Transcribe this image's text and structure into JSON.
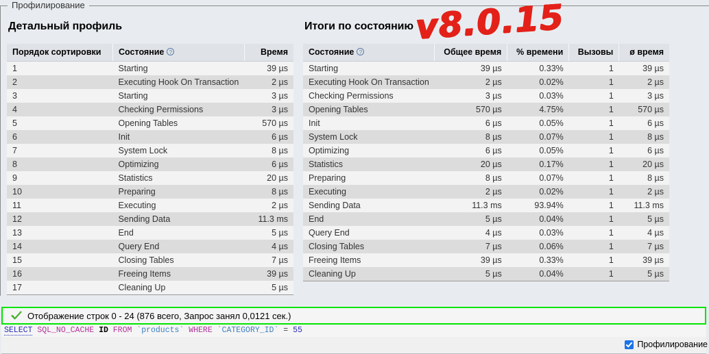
{
  "fieldset": {
    "legend": "Профилирование"
  },
  "version_annotation": "v8.0.15",
  "detailed_profile": {
    "title": "Детальный профиль",
    "columns": [
      "Порядок сортировки",
      "Состояние",
      "Время"
    ],
    "help_glyph": "?",
    "rows": [
      {
        "order": "1",
        "state": "Starting",
        "time": "39 µs"
      },
      {
        "order": "2",
        "state": "Executing Hook On Transaction",
        "time": "2 µs"
      },
      {
        "order": "3",
        "state": "Starting",
        "time": "3 µs"
      },
      {
        "order": "4",
        "state": "Checking Permissions",
        "time": "3 µs"
      },
      {
        "order": "5",
        "state": "Opening Tables",
        "time": "570 µs"
      },
      {
        "order": "6",
        "state": "Init",
        "time": "6 µs"
      },
      {
        "order": "7",
        "state": "System Lock",
        "time": "8 µs"
      },
      {
        "order": "8",
        "state": "Optimizing",
        "time": "6 µs"
      },
      {
        "order": "9",
        "state": "Statistics",
        "time": "20 µs"
      },
      {
        "order": "10",
        "state": "Preparing",
        "time": "8 µs"
      },
      {
        "order": "11",
        "state": "Executing",
        "time": "2 µs"
      },
      {
        "order": "12",
        "state": "Sending Data",
        "time": "11.3 ms"
      },
      {
        "order": "13",
        "state": "End",
        "time": "5 µs"
      },
      {
        "order": "14",
        "state": "Query End",
        "time": "4 µs"
      },
      {
        "order": "15",
        "state": "Closing Tables",
        "time": "7 µs"
      },
      {
        "order": "16",
        "state": "Freeing Items",
        "time": "39 µs"
      },
      {
        "order": "17",
        "state": "Cleaning Up",
        "time": "5 µs"
      }
    ]
  },
  "state_summary": {
    "title": "Итоги по состоянию",
    "columns": [
      "Состояние",
      "Общее время",
      "% времени",
      "Вызовы",
      "ø время"
    ],
    "help_glyph": "?",
    "rows": [
      {
        "state": "Starting",
        "total": "39 µs",
        "percent": "0.33%",
        "calls": "1",
        "avg": "39 µs"
      },
      {
        "state": "Executing Hook On Transaction",
        "total": "2 µs",
        "percent": "0.02%",
        "calls": "1",
        "avg": "2 µs"
      },
      {
        "state": "Checking Permissions",
        "total": "3 µs",
        "percent": "0.03%",
        "calls": "1",
        "avg": "3 µs"
      },
      {
        "state": "Opening Tables",
        "total": "570 µs",
        "percent": "4.75%",
        "calls": "1",
        "avg": "570 µs"
      },
      {
        "state": "Init",
        "total": "6 µs",
        "percent": "0.05%",
        "calls": "1",
        "avg": "6 µs"
      },
      {
        "state": "System Lock",
        "total": "8 µs",
        "percent": "0.07%",
        "calls": "1",
        "avg": "8 µs"
      },
      {
        "state": "Optimizing",
        "total": "6 µs",
        "percent": "0.05%",
        "calls": "1",
        "avg": "6 µs"
      },
      {
        "state": "Statistics",
        "total": "20 µs",
        "percent": "0.17%",
        "calls": "1",
        "avg": "20 µs"
      },
      {
        "state": "Preparing",
        "total": "8 µs",
        "percent": "0.07%",
        "calls": "1",
        "avg": "8 µs"
      },
      {
        "state": "Executing",
        "total": "2 µs",
        "percent": "0.02%",
        "calls": "1",
        "avg": "2 µs"
      },
      {
        "state": "Sending Data",
        "total": "11.3 ms",
        "percent": "93.94%",
        "calls": "1",
        "avg": "11.3 ms"
      },
      {
        "state": "End",
        "total": "5 µs",
        "percent": "0.04%",
        "calls": "1",
        "avg": "5 µs"
      },
      {
        "state": "Query End",
        "total": "4 µs",
        "percent": "0.03%",
        "calls": "1",
        "avg": "4 µs"
      },
      {
        "state": "Closing Tables",
        "total": "7 µs",
        "percent": "0.06%",
        "calls": "1",
        "avg": "7 µs"
      },
      {
        "state": "Freeing Items",
        "total": "39 µs",
        "percent": "0.33%",
        "calls": "1",
        "avg": "39 µs"
      },
      {
        "state": "Cleaning Up",
        "total": "5 µs",
        "percent": "0.04%",
        "calls": "1",
        "avg": "5 µs"
      }
    ]
  },
  "status": {
    "icon": "green-check-icon",
    "message": "Отображение строк 0 - 24 (876 всего, Запрос занял 0,0121 сек.)",
    "border_color": "#00e500"
  },
  "sql": {
    "tokens": [
      {
        "text": "SELECT",
        "kind": "kw-select"
      },
      {
        "text": " ",
        "kind": "punct"
      },
      {
        "text": "SQL_NO_CACHE",
        "kind": "kw-func"
      },
      {
        "text": " ",
        "kind": "punct"
      },
      {
        "text": "ID",
        "kind": "kw-alpha"
      },
      {
        "text": " ",
        "kind": "punct"
      },
      {
        "text": "FROM",
        "kind": "kw"
      },
      {
        "text": " ",
        "kind": "punct"
      },
      {
        "text": "`products`",
        "kind": "ident"
      },
      {
        "text": " ",
        "kind": "punct"
      },
      {
        "text": "WHERE",
        "kind": "kw"
      },
      {
        "text": " ",
        "kind": "punct"
      },
      {
        "text": "`CATEGORY_ID`",
        "kind": "ident"
      },
      {
        "text": " ",
        "kind": "punct"
      },
      {
        "text": "=",
        "kind": "punct"
      },
      {
        "text": " ",
        "kind": "punct"
      },
      {
        "text": "55",
        "kind": "digit"
      }
    ]
  },
  "footer": {
    "profiling_checkbox_label": "Профилирование",
    "profiling_checkbox_checked": true,
    "accent_color": "#1a73e8"
  }
}
